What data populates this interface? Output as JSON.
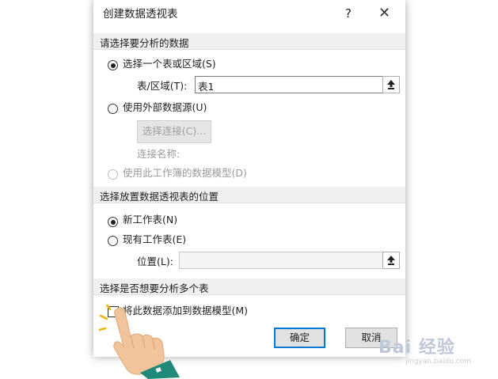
{
  "dialog": {
    "title": "创建数据透视表",
    "help_label": "?",
    "close_label": "✕"
  },
  "section1": {
    "header": "请选择要分析的数据",
    "option_select_range": "选择一个表或区域(S)",
    "range_label": "表/区域(T):",
    "range_value": "表1",
    "option_external": "使用外部数据源(U)",
    "choose_connection": "选择连接(C)...",
    "connection_name_label": "连接名称:",
    "option_data_model": "使用此工作簿的数据模型(D)"
  },
  "section2": {
    "header": "选择放置数据透视表的位置",
    "option_new_sheet": "新工作表(N)",
    "option_existing_sheet": "现有工作表(E)",
    "location_label": "位置(L):",
    "location_value": ""
  },
  "section3": {
    "header": "选择是否想要分析多个表",
    "add_to_model": "将此数据添加到数据模型(M)"
  },
  "buttons": {
    "ok": "确定",
    "cancel": "取消"
  },
  "watermark": {
    "text": "Bai 经验",
    "url": "jingyan.baidu.com"
  }
}
